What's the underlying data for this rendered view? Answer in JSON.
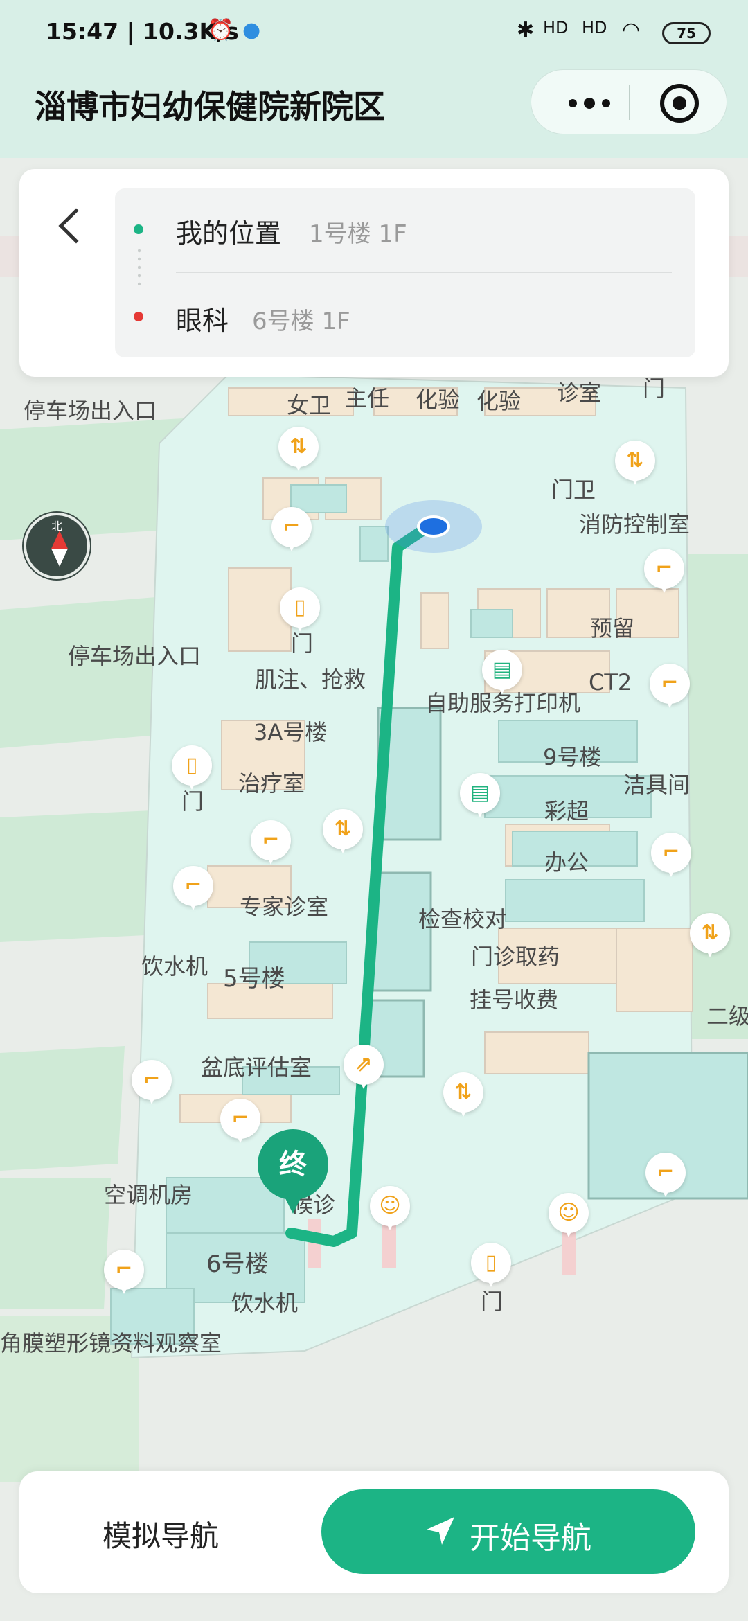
{
  "status_bar": {
    "time": "15:47 | 10.3K/s",
    "battery": "75",
    "signal_1": "HD",
    "signal_2": "HD"
  },
  "header": {
    "title": "淄博市妇幼保健院新院区"
  },
  "route": {
    "origin_name": "我的位置",
    "origin_location": "1号楼 1F",
    "destination_name": "眼科",
    "destination_location": "6号楼 1F",
    "origin_color": "#1cb485",
    "destination_color": "#e53935"
  },
  "compass": {
    "north_label": "北"
  },
  "map_labels": {
    "parking_exit_1": "停车场出入口",
    "parking_exit_2": "停车场出入口",
    "womens_restroom": "女卫",
    "director": "主任",
    "lab_1": "化验",
    "lab_2": "化验",
    "clinic_room": "诊室",
    "door_top": "门",
    "gate_guard": "门卫",
    "fire_control": "消防控制室",
    "reserved": "预留",
    "door_1": "门",
    "injection": "肌注、抢救",
    "self_print": "自助服务打印机",
    "ct2": "CT2",
    "building_3a": "3A号楼",
    "building_9": "9号楼",
    "treatment": "治疗室",
    "janitor": "洁具间",
    "door_2": "门",
    "ultrasound": "彩超",
    "office": "办公",
    "expert_clinic": "专家诊室",
    "check_counter": "检查校对",
    "pharmacy": "门诊取药",
    "water_1": "饮水机",
    "building_5": "5号楼",
    "registration": "挂号收费",
    "level_2": "二级",
    "pelvic": "盆底评估室",
    "hvac": "空调机房",
    "clinic_end": "候诊",
    "building_6": "6号楼",
    "water_2": "饮水机",
    "door_3": "门",
    "cornea": "角膜塑形镜资料观察室"
  },
  "end_marker": {
    "label": "终"
  },
  "bottom": {
    "simulate_label": "模拟导航",
    "start_label": "开始导航"
  },
  "colors": {
    "route_line": "#1cb485",
    "accent": "#1cb485",
    "header_bg": "#d8efe7"
  }
}
